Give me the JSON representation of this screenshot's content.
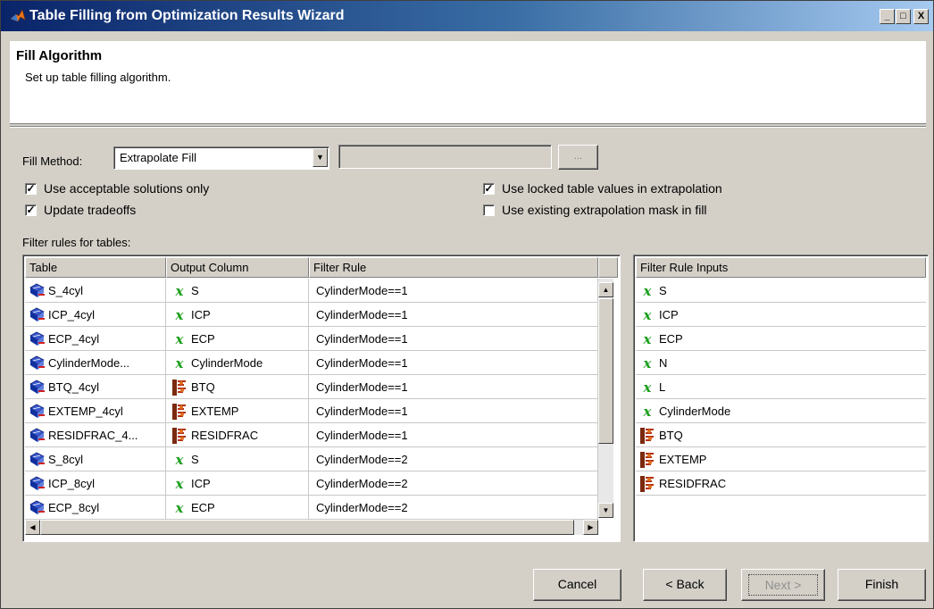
{
  "window": {
    "title": "Table Filling from Optimization Results Wizard",
    "controls": {
      "minimize": "_",
      "maximize": "□",
      "close": "X"
    }
  },
  "header": {
    "step_title": "Fill Algorithm",
    "step_subtitle": "Set up table filling algorithm."
  },
  "fill": {
    "method_label": "Fill Method:",
    "method_value": "Extrapolate Fill",
    "browse_label": "..."
  },
  "options": {
    "acceptable_only": {
      "label": "Use acceptable solutions only",
      "checked": true
    },
    "update_tradeoffs": {
      "label": "Update tradeoffs",
      "checked": true
    },
    "locked_values": {
      "label": "Use locked table values in extrapolation",
      "checked": true
    },
    "existing_mask": {
      "label": "Use existing extrapolation mask in fill",
      "checked": false
    }
  },
  "filter_rules": {
    "label": "Filter rules for tables:",
    "columns": [
      "Table",
      "Output Column",
      "Filter Rule"
    ],
    "rows": [
      {
        "table": "S_4cyl",
        "output_icon": "x-variable-icon",
        "output": "S",
        "rule": "CylinderMode==1"
      },
      {
        "table": "ICP_4cyl",
        "output_icon": "x-variable-icon",
        "output": "ICP",
        "rule": "CylinderMode==1"
      },
      {
        "table": "ECP_4cyl",
        "output_icon": "x-variable-icon",
        "output": "ECP",
        "rule": "CylinderMode==1"
      },
      {
        "table": "CylinderMode...",
        "output_icon": "x-variable-icon",
        "output": "CylinderMode",
        "rule": "CylinderMode==1"
      },
      {
        "table": "BTQ_4cyl",
        "output_icon": "response-model-icon",
        "output": "BTQ",
        "rule": "CylinderMode==1"
      },
      {
        "table": "EXTEMP_4cyl",
        "output_icon": "response-model-icon",
        "output": "EXTEMP",
        "rule": "CylinderMode==1"
      },
      {
        "table": "RESIDFRAC_4...",
        "output_icon": "response-model-icon",
        "output": "RESIDFRAC",
        "rule": "CylinderMode==1"
      },
      {
        "table": "S_8cyl",
        "output_icon": "x-variable-icon",
        "output": "S",
        "rule": "CylinderMode==2"
      },
      {
        "table": "ICP_8cyl",
        "output_icon": "x-variable-icon",
        "output": "ICP",
        "rule": "CylinderMode==2"
      },
      {
        "table": "ECP_8cyl",
        "output_icon": "x-variable-icon",
        "output": "ECP",
        "rule": "CylinderMode==2"
      }
    ]
  },
  "rule_inputs": {
    "header": "Filter Rule Inputs",
    "items": [
      {
        "icon": "x-variable-icon",
        "label": "S"
      },
      {
        "icon": "x-variable-icon",
        "label": "ICP"
      },
      {
        "icon": "x-variable-icon",
        "label": "ECP"
      },
      {
        "icon": "x-variable-icon",
        "label": "N"
      },
      {
        "icon": "x-variable-icon",
        "label": "L"
      },
      {
        "icon": "x-variable-icon",
        "label": "CylinderMode"
      },
      {
        "icon": "response-model-icon",
        "label": "BTQ"
      },
      {
        "icon": "response-model-icon",
        "label": "EXTEMP"
      },
      {
        "icon": "response-model-icon",
        "label": "RESIDFRAC"
      }
    ]
  },
  "footer": {
    "cancel": "Cancel",
    "back": "< Back",
    "next": "Next >",
    "finish": "Finish"
  },
  "colors": {
    "x_icon": "#1a9e1a",
    "title_start": "#0a246a",
    "title_end": "#a6caf0"
  }
}
